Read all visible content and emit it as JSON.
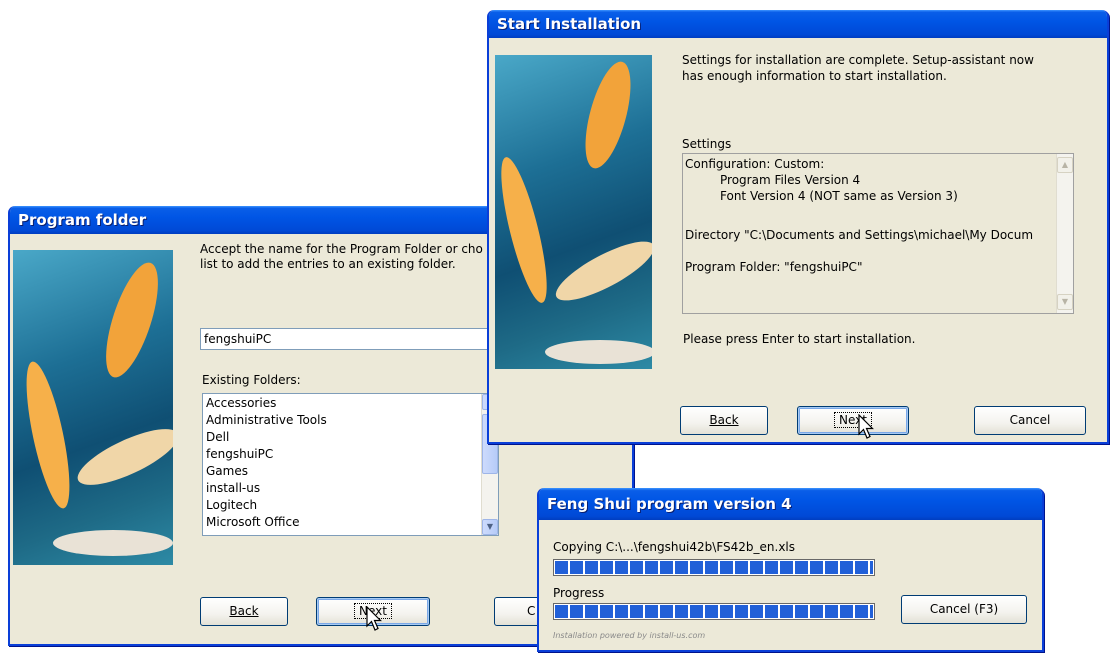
{
  "program_folder": {
    "title": "Program folder",
    "instructions_line1": "Accept the name for the Program Folder or cho",
    "instructions_line2": "list to add the entries to an existing folder.",
    "folder_name_value": "fengshuiPC",
    "existing_folders_label": "Existing Folders:",
    "folders": [
      "Accessories",
      "Administrative Tools",
      "Dell",
      "fengshuiPC",
      "Games",
      "install-us",
      "Logitech",
      "Microsoft Office"
    ],
    "back_label": "Back",
    "next_label": "Next",
    "cancel_partial": "C"
  },
  "start_installation": {
    "title": "Start Installation",
    "intro_line1": "Settings for installation are complete. Setup-assistant now",
    "intro_line2": "has enough information to start installation.",
    "settings_label": "Settings",
    "settings_lines": [
      "Configuration: Custom:",
      "Program Files Version 4",
      "Font Version 4 (NOT same as Version 3)",
      "Directory \"C:\\Documents and Settings\\michael\\My Docum",
      "Program Folder: \"fengshuiPC\""
    ],
    "prompt": "Please press Enter to start installation.",
    "back_label": "Back",
    "next_label": "Next",
    "cancel_label": "Cancel"
  },
  "progress_dialog": {
    "title": "Feng Shui program version 4",
    "copying_text": "Copying C:\\...\\fengshui42b\\FS42b_en.xls",
    "file_progress": 1.0,
    "progress_label": "Progress",
    "overall_progress": 1.0,
    "cancel_label": "Cancel (F3)",
    "footer": "Installation powered by install-us.com"
  },
  "colors": {
    "titlebar": "#0055e5",
    "dialog_bg": "#ece9d8",
    "progress_fill": "#2160d8"
  },
  "icons": [
    "mouse-pointer-icon",
    "chevron-up-icon",
    "chevron-down-icon"
  ]
}
